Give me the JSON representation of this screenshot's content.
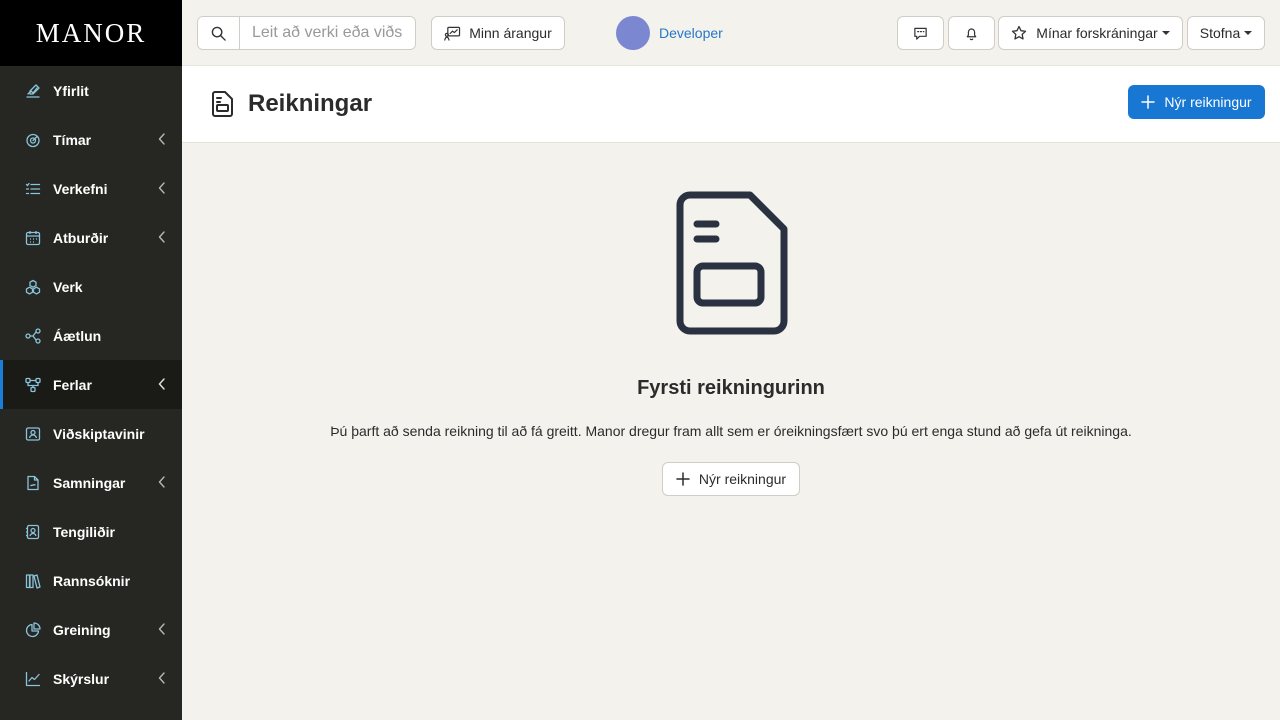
{
  "brand": {
    "logo_text": "MANOR"
  },
  "sidebar": {
    "items": [
      {
        "label": "Yfirlit",
        "icon": "chart-pen-icon",
        "expandable": false,
        "active": false
      },
      {
        "label": "Tímar",
        "icon": "timer-icon",
        "expandable": true,
        "active": false
      },
      {
        "label": "Verkefni",
        "icon": "checklist-icon",
        "expandable": true,
        "active": false
      },
      {
        "label": "Atburðir",
        "icon": "calendar-icon",
        "expandable": true,
        "active": false
      },
      {
        "label": "Verk",
        "icon": "cubes-icon",
        "expandable": false,
        "active": false
      },
      {
        "label": "Áætlun",
        "icon": "graph-nodes-icon",
        "expandable": false,
        "active": false
      },
      {
        "label": "Ferlar",
        "icon": "workflow-icon",
        "expandable": true,
        "active": true
      },
      {
        "label": "Viðskiptavinir",
        "icon": "customers-icon",
        "expandable": false,
        "active": false
      },
      {
        "label": "Samningar",
        "icon": "contract-icon",
        "expandable": true,
        "active": false
      },
      {
        "label": "Tengiliðir",
        "icon": "contact-card-icon",
        "expandable": false,
        "active": false
      },
      {
        "label": "Rannsóknir",
        "icon": "books-icon",
        "expandable": false,
        "active": false
      },
      {
        "label": "Greining",
        "icon": "pie-chart-icon",
        "expandable": true,
        "active": false
      },
      {
        "label": "Skýrslur",
        "icon": "line-chart-icon",
        "expandable": true,
        "active": false
      }
    ]
  },
  "topbar": {
    "search_placeholder": "Leit að verki eða viðskiptavini",
    "achievements_label": "Minn árangur",
    "user_name": "Developer",
    "favorites_label": "Mínar forskráningar",
    "create_label": "Stofna"
  },
  "page": {
    "title": "Reikningar",
    "new_button_label": "Nýr reikningur"
  },
  "empty_state": {
    "title": "Fyrsti reikningurinn",
    "description": "Þú þarft að senda reikning til að fá greitt. Manor dregur fram allt sem er óreikningsfært svo þú ert enga stund að gefa út reikninga.",
    "button_label": "Nýr reikningur"
  },
  "colors": {
    "sidebar_bg": "#262622",
    "logo_bg": "#000000",
    "icon_accent": "#8ac4dc",
    "active_indicator": "#1a7fd8",
    "primary_button": "#1777d3",
    "link": "#2777c9",
    "avatar": "#7b87d1",
    "page_bg": "#f3f2ed"
  }
}
